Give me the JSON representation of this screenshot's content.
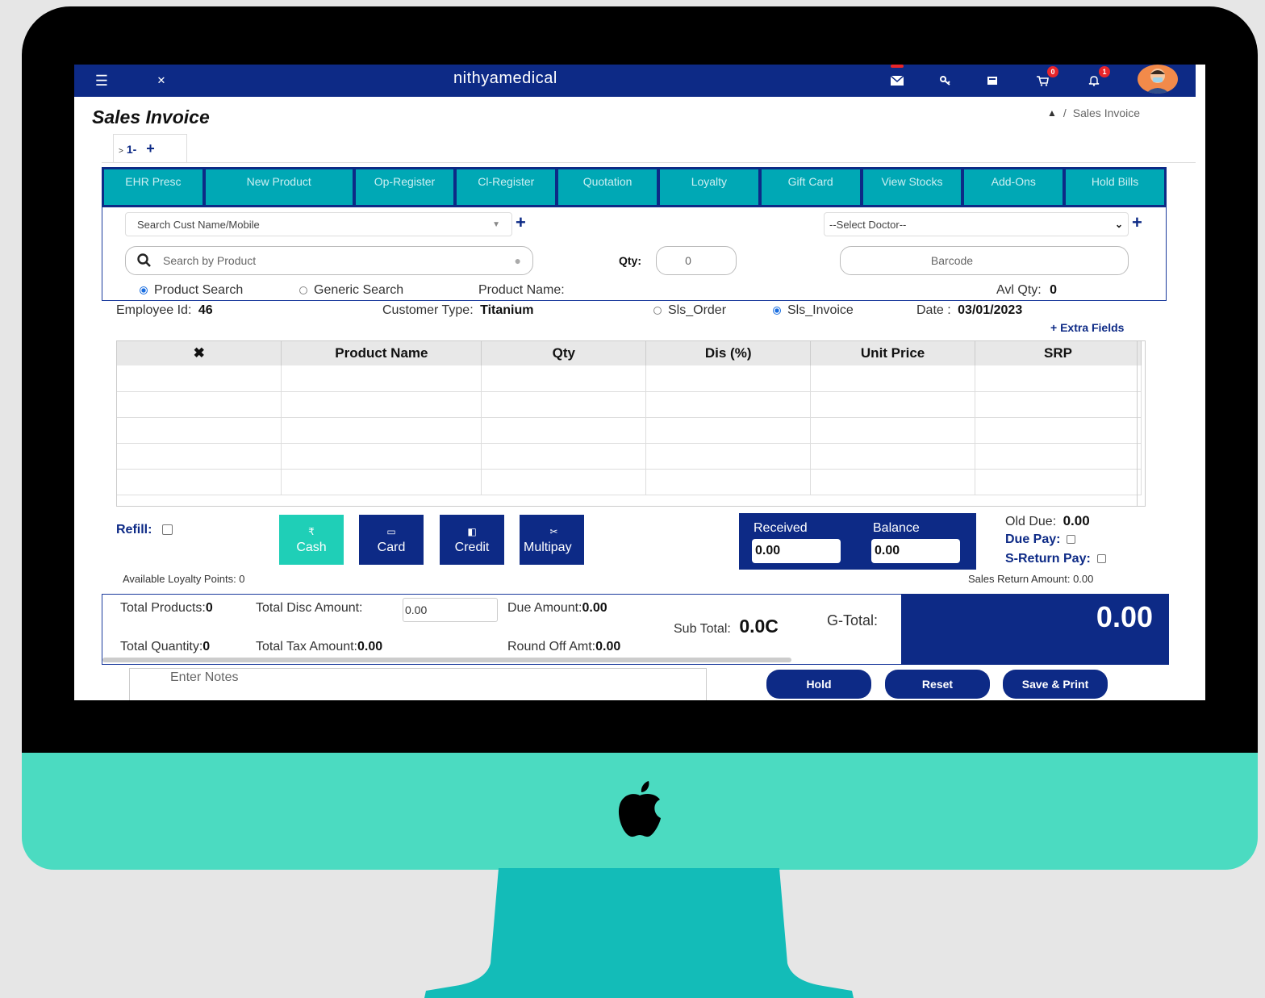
{
  "header": {
    "app_title": "nithyamedical",
    "cart_badge": "0",
    "notif_badge": "1",
    "icons": [
      "menu-icon",
      "expand-icon",
      "mail-icon",
      "key-icon",
      "calculator-icon",
      "cart-icon",
      "bell-icon",
      "user-avatar"
    ]
  },
  "page": {
    "title": "Sales Invoice",
    "breadcrumb": [
      "Sales Invoice"
    ]
  },
  "invoice_tab": {
    "label": "1-",
    "add": "+",
    "prefix": ">"
  },
  "nav_buttons": [
    {
      "label": "EHR Presc"
    },
    {
      "label": "New Product"
    },
    {
      "label": "Op-Register"
    },
    {
      "label": "Cl-Register"
    },
    {
      "label": "Quotation"
    },
    {
      "label": "Loyalty"
    },
    {
      "label": "Gift Card"
    },
    {
      "label": "View Stocks"
    },
    {
      "label": "Add-Ons"
    },
    {
      "label": "Hold Bills"
    }
  ],
  "search": {
    "customer_placeholder": "Search Cust Name/Mobile",
    "doctor_selected": "--Select Doctor--",
    "product_placeholder": "Search by Product",
    "qty_label": "Qty:",
    "qty_value": "0",
    "barcode_placeholder": "Barcode",
    "radio_product": "Product Search",
    "radio_generic": "Generic Search",
    "product_name_label": "Product Name:",
    "avl_qty_label": "Avl Qty:",
    "avl_qty_value": "0"
  },
  "meta": {
    "employee_label": "Employee Id:",
    "employee_id": "46",
    "customer_type_label": "Customer Type:",
    "customer_type": "Titanium",
    "sls_order": "Sls_Order",
    "sls_invoice": "Sls_Invoice",
    "date_label": "Date :",
    "date": "03/01/2023",
    "extra_fields": "Extra Fields"
  },
  "table": {
    "columns": [
      "✖",
      "Product Name",
      "Qty",
      "Dis (%)",
      "Unit Price",
      "SRP"
    ],
    "rows": [
      [
        "",
        "",
        "",
        "",
        "",
        ""
      ],
      [
        "",
        "",
        "",
        "",
        "",
        ""
      ],
      [
        "",
        "",
        "",
        "",
        "",
        ""
      ],
      [
        "",
        "",
        "",
        "",
        "",
        ""
      ],
      [
        "",
        "",
        "",
        "",
        "",
        ""
      ]
    ]
  },
  "payment": {
    "refill_label": "Refill:",
    "buttons": [
      {
        "label": "Cash",
        "icon": "₹",
        "color": "#1fcfb7"
      },
      {
        "label": "Card",
        "icon": "▭",
        "color": "#0d2a86"
      },
      {
        "label": "Credit",
        "icon": "◧",
        "color": "#0d2a86"
      },
      {
        "label": "Multipay",
        "icon": "✂",
        "color": "#0d2a86"
      }
    ],
    "received_label": "Received",
    "received_value": "0.00",
    "balance_label": "Balance",
    "balance_value": "0.00",
    "old_due_label": "Old Due:",
    "old_due_value": "0.00",
    "due_pay_label": "Due Pay:",
    "s_return_label": "S-Return Pay:",
    "loyalty_text": "Available Loyalty Points: 0",
    "sales_return_text": "Sales Return Amount: 0.00"
  },
  "summary": {
    "total_products_label": "Total Products:",
    "total_products": "0",
    "total_disc_label": "Total Disc Amount:",
    "total_disc": "0.00",
    "due_amount_label": "Due Amount:",
    "due_amount": "0.00",
    "sub_total_label": "Sub Total:",
    "sub_total": "0.0C",
    "g_total_label": "G-Total:",
    "g_total": "0.00",
    "total_qty_label": "Total Quantity:",
    "total_qty": "0",
    "total_tax_label": "Total Tax Amount:",
    "total_tax": "0.00",
    "round_off_label": "Round Off Amt:",
    "round_off": "0.00"
  },
  "footer": {
    "notes_placeholder": "Enter Notes",
    "hold": "Hold",
    "reset": "Reset",
    "save_print": "Save & Print"
  }
}
